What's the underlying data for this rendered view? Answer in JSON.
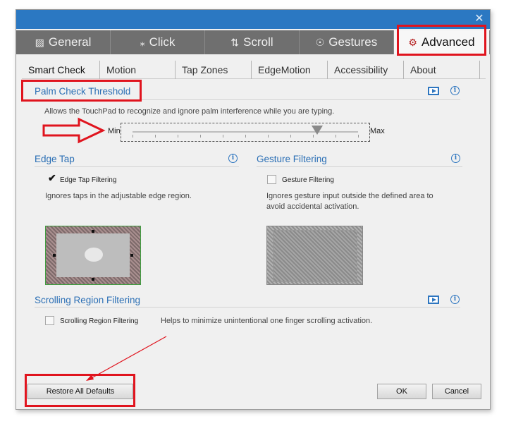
{
  "window": {
    "close_glyph": "✕",
    "titlebar_color": "#2b78c2"
  },
  "main_tabs": [
    {
      "label": "General",
      "icon": "touchpad-icon",
      "glyph": "▨"
    },
    {
      "label": "Click",
      "icon": "click-icon",
      "glyph": "⁎"
    },
    {
      "label": "Scroll",
      "icon": "scroll-icon",
      "glyph": "⇅"
    },
    {
      "label": "Gestures",
      "icon": "gestures-icon",
      "glyph": "☉"
    },
    {
      "label": "Advanced",
      "icon": "gear-icon",
      "glyph": "⚙"
    }
  ],
  "active_main_tab": "Advanced",
  "sub_tabs": [
    "Smart Check",
    "Motion",
    "Tap Zones",
    "EdgeMotion",
    "Accessibility",
    "About"
  ],
  "palm": {
    "title": "Palm Check Threshold",
    "description": "Allows the TouchPad to recognize and ignore palm interference while you are typing.",
    "min_label": "Min",
    "max_label": "Max",
    "slider_level": 0.82
  },
  "edge_tap": {
    "title": "Edge Tap",
    "checkbox_label": "Edge Tap Filtering",
    "checked": true,
    "description": "Ignores taps in the adjustable edge region."
  },
  "gesture_filtering": {
    "title": "Gesture Filtering",
    "checkbox_label": "Gesture Filtering",
    "checked": false,
    "description_line1": "Ignores gesture input outside the defined area to",
    "description_line2": "avoid accidental activation."
  },
  "scrolling": {
    "title": "Scrolling Region Filtering",
    "checkbox_label": "Scrolling Region Filtering",
    "checked": false,
    "description": "Helps to minimize unintentional one finger scrolling activation."
  },
  "buttons": {
    "restore": "Restore All Defaults",
    "ok": "OK",
    "cancel": "Cancel"
  },
  "colors": {
    "accent_text": "#2b6fb5",
    "annotation_red": "#e0141e"
  }
}
